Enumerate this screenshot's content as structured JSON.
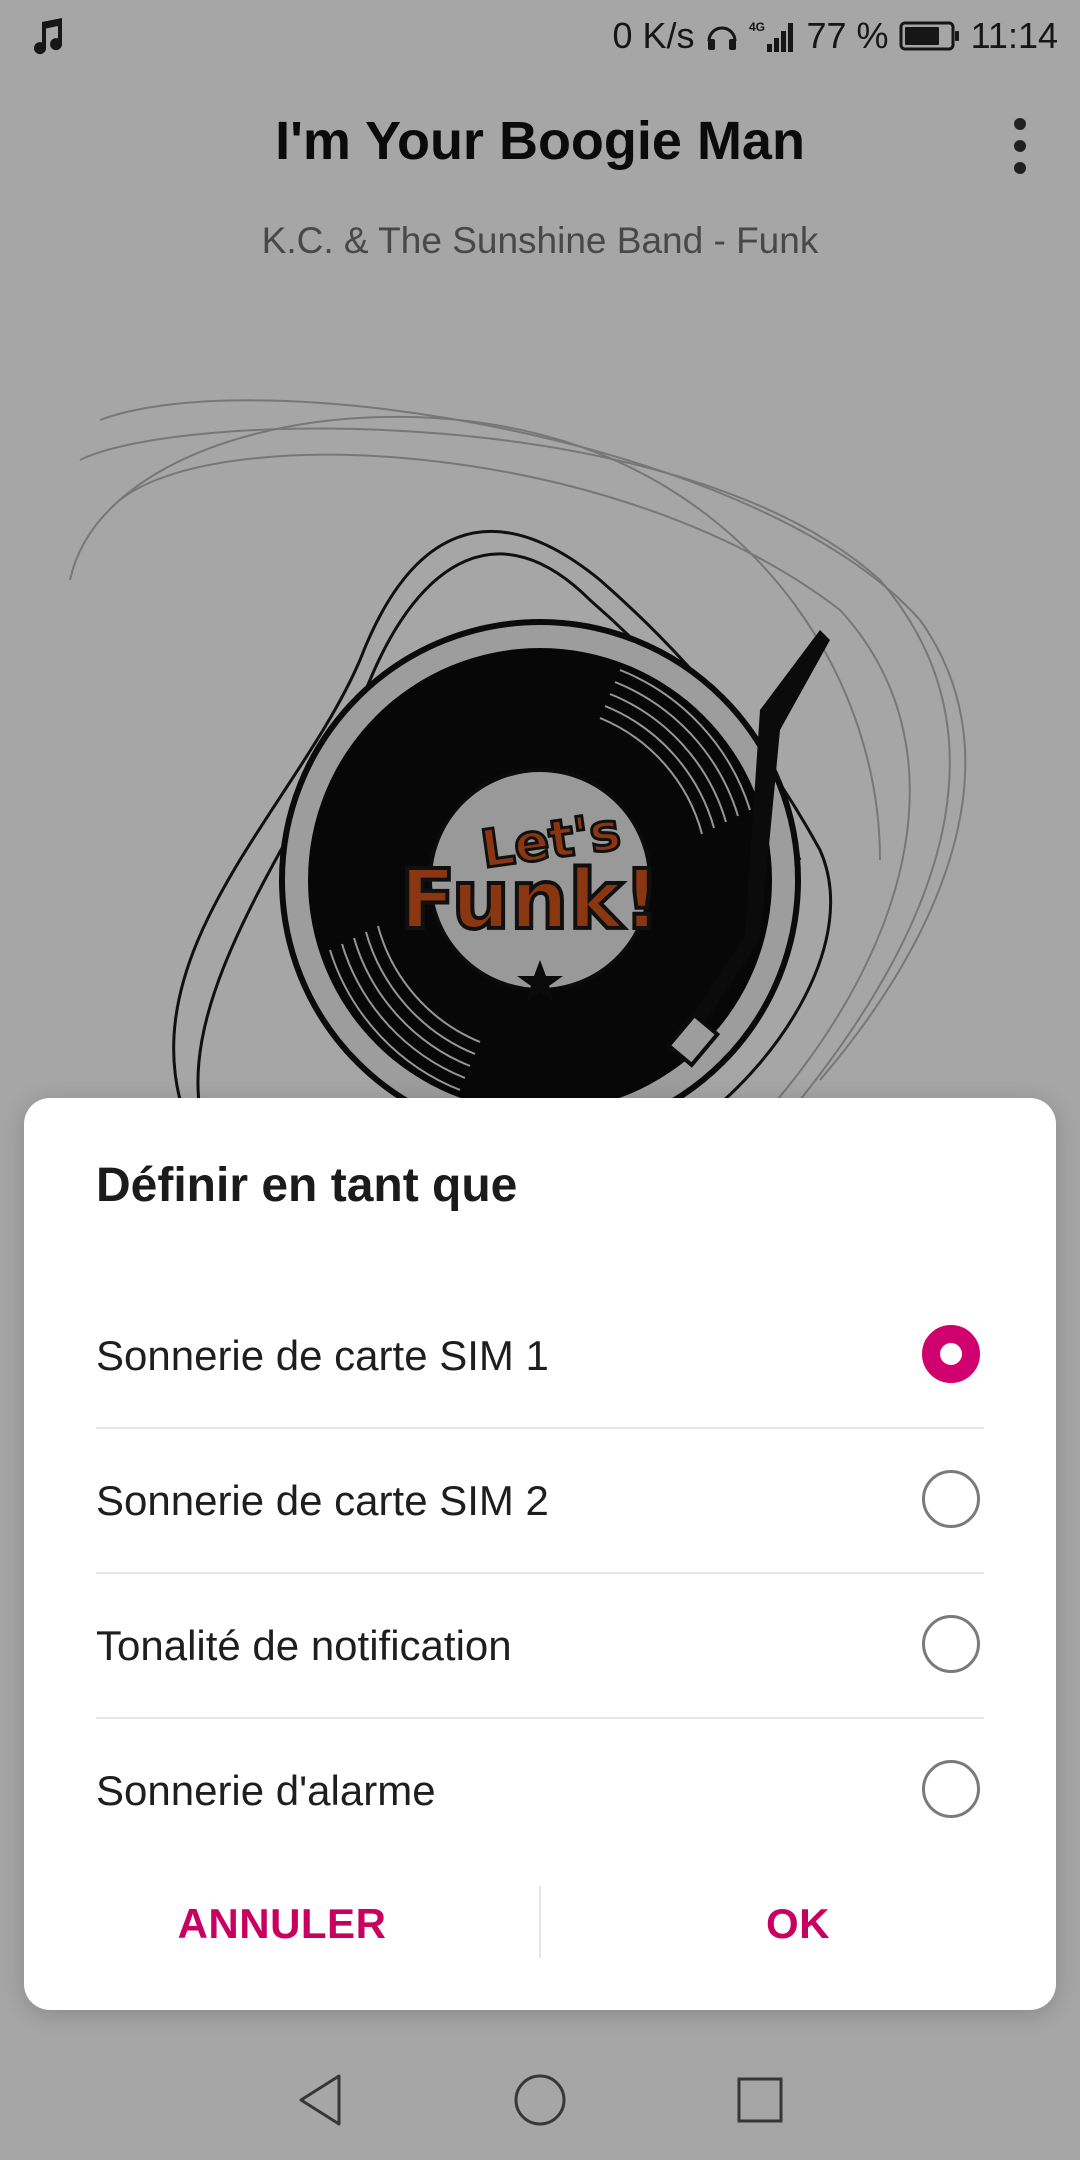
{
  "status_bar": {
    "network_speed": "0 K/s",
    "network_type": "4G",
    "battery": "77 %",
    "time": "11:14",
    "icons": [
      "music-note-icon",
      "headphones-icon",
      "signal-icon",
      "battery-icon"
    ]
  },
  "player": {
    "title": "I'm Your Boogie Man",
    "subtitle": "K.C. & The Sunshine Band - Funk",
    "artwork_text_top": "Let's",
    "artwork_text_bottom": "Funk!",
    "menu_icon": "more-vert-icon"
  },
  "dialog": {
    "title": "Définir en tant que",
    "options": [
      {
        "label": "Sonnerie de carte SIM 1",
        "selected": true
      },
      {
        "label": "Sonnerie de carte SIM 2",
        "selected": false
      },
      {
        "label": "Tonalité de notification",
        "selected": false
      },
      {
        "label": "Sonnerie d'alarme",
        "selected": false
      }
    ],
    "cancel_label": "ANNULER",
    "ok_label": "OK"
  },
  "colors": {
    "accent": "#d1006f",
    "button_text": "#c8005f",
    "scrim": "rgba(0,0,0,0.35)"
  },
  "navbar": {
    "icons": [
      "back-icon",
      "home-icon",
      "recents-icon"
    ]
  }
}
